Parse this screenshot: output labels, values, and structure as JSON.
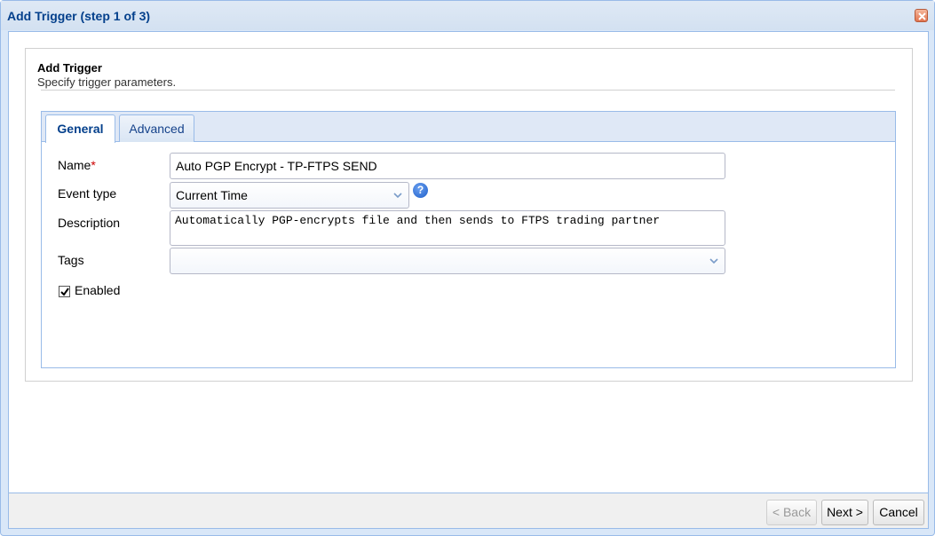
{
  "dialog": {
    "title": "Add Trigger (step 1 of 3)"
  },
  "header": {
    "title": "Add Trigger",
    "subtitle": "Specify trigger parameters."
  },
  "tabs": [
    {
      "label": "General",
      "active": true
    },
    {
      "label": "Advanced",
      "active": false
    }
  ],
  "form": {
    "name_label": "Name",
    "required_marker": "*",
    "name_value": "Auto PGP Encrypt - TP-FTPS SEND",
    "event_type_label": "Event type",
    "event_type_value": "Current Time",
    "description_label": "Description",
    "description_value": "Automatically PGP-encrypts file and then sends to FTPS trading partner",
    "tags_label": "Tags",
    "tags_value": "",
    "enabled_label": "Enabled",
    "enabled_checked": true
  },
  "footer": {
    "back_label": "< Back",
    "next_label": "Next >",
    "cancel_label": "Cancel"
  },
  "icons": {
    "close": "close-icon",
    "help": "help-icon",
    "chevron": "chevron-down-icon",
    "check": "checkmark-icon"
  },
  "colors": {
    "title_text": "#04408c",
    "frame_border": "#99bbe8",
    "required": "#cc0000",
    "help_icon": "#1f5fc9"
  }
}
